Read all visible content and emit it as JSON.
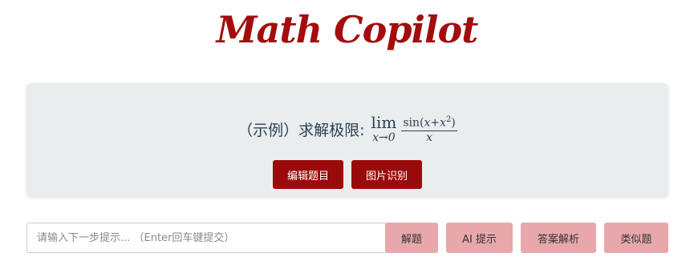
{
  "app": {
    "title": "Math Copilot"
  },
  "problem": {
    "prefix": "（示例）求解极限:",
    "lim": "lim",
    "lim_subscript": "x→0",
    "numerator_func": "sin(",
    "numerator_x": "x",
    "numerator_plus": "+",
    "numerator_x2": "x",
    "numerator_exp": "2",
    "numerator_close": ")",
    "denominator": "x"
  },
  "card_buttons": {
    "edit": "编辑题目",
    "image": "图片识别"
  },
  "input": {
    "value": "",
    "placeholder": "请输入下一步提示... （Enter回车键提交）"
  },
  "actions": {
    "solve": "解题",
    "hint": "AI 提示",
    "answer": "答案解析",
    "similar": "类似题"
  },
  "colors": {
    "brand": "#a30d0d",
    "button_dark": "#9b0a0a",
    "button_light": "#e8a8ab",
    "card_bg": "#e9edee"
  }
}
